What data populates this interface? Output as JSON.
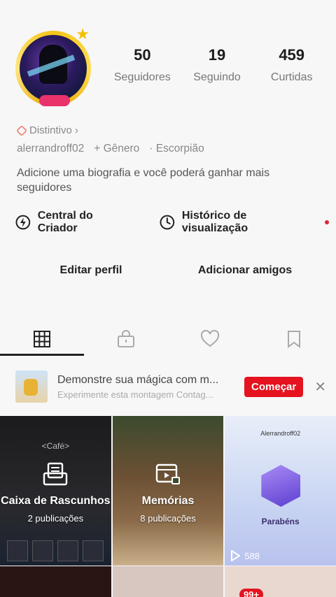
{
  "profile": {
    "followers_count": "50",
    "followers_label": "Seguidores",
    "following_count": "19",
    "following_label": "Seguindo",
    "likes_count": "459",
    "likes_label": "Curtidas",
    "badge_label": "Distintivo",
    "username": "alerrandroff02",
    "gender_label": "+ Gênero",
    "sign_label": "· Escorpião",
    "bio_placeholder": "Adicione uma biografia e você poderá ganhar mais seguidores"
  },
  "links": {
    "creator_center": "Central do Criador",
    "view_history": "Histórico de visualização"
  },
  "actions": {
    "edit_profile": "Editar perfil",
    "add_friends": "Adicionar amigos"
  },
  "tabs": [
    "grid-icon",
    "lock-icon",
    "heart-icon",
    "bookmark-icon"
  ],
  "promo": {
    "title": "Demonstre sua mágica com m...",
    "subtitle": "Experimente esta montagem Contag...",
    "button": "Começar"
  },
  "grid": {
    "drafts_cafe": "<Café>",
    "drafts_title": "Caixa de Rascunhos",
    "drafts_count": "2 publicações",
    "memories_title": "Memórias",
    "memories_count": "8 publicações",
    "card_user": "Alerrandroff02",
    "card_congrats": "Parabéns",
    "card_plays": "588"
  },
  "bottom_nav": {
    "notification_badge": "99+"
  },
  "colors": {
    "accent_red": "#e5131f",
    "text_primary": "#222222",
    "text_secondary": "#888888"
  }
}
